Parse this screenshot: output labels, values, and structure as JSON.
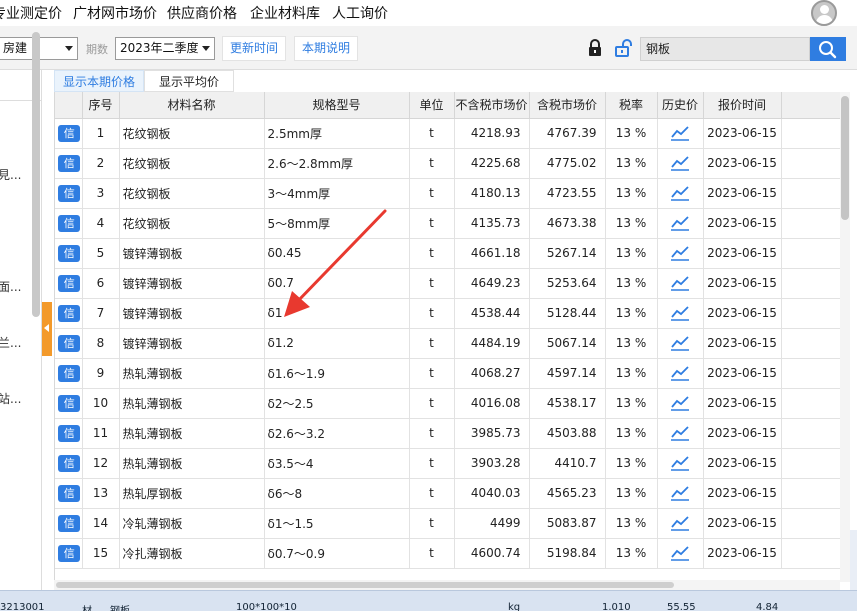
{
  "top_nav": {
    "items": [
      "专业测定价",
      "广材网市场价",
      "供应商价格",
      "企业材料库",
      "人工询价"
    ]
  },
  "toolbar": {
    "region_value": "房建",
    "period_label": "期数",
    "period_value": "2023年二季度",
    "update_time_label": "更新时间",
    "period_note_label": "本期说明",
    "search_value": "钢板"
  },
  "tabs": {
    "current": "显示本期价格",
    "average": "显示平均价"
  },
  "left_panel": {
    "fragments": [
      "見...",
      "面...",
      "兰...",
      "站..."
    ]
  },
  "table": {
    "headers": [
      "序号",
      "材料名称",
      "规格型号",
      "单位",
      "不含税市场价",
      "含税市场价",
      "税率",
      "历史价",
      "报价时间"
    ],
    "badge_text": "信",
    "rows": [
      [
        "1",
        "花纹钢板",
        "2.5mm厚",
        "t",
        "4218.93",
        "4767.39",
        "13 %",
        "2023-06-15"
      ],
      [
        "2",
        "花纹钢板",
        "2.6～2.8mm厚",
        "t",
        "4225.68",
        "4775.02",
        "13 %",
        "2023-06-15"
      ],
      [
        "3",
        "花纹钢板",
        "3～4mm厚",
        "t",
        "4180.13",
        "4723.55",
        "13 %",
        "2023-06-15"
      ],
      [
        "4",
        "花纹钢板",
        "5～8mm厚",
        "t",
        "4135.73",
        "4673.38",
        "13 %",
        "2023-06-15"
      ],
      [
        "5",
        "镀锌薄钢板",
        "δ0.45",
        "t",
        "4661.18",
        "5267.14",
        "13 %",
        "2023-06-15"
      ],
      [
        "6",
        "镀锌薄钢板",
        "δ0.7",
        "t",
        "4649.23",
        "5253.64",
        "13 %",
        "2023-06-15"
      ],
      [
        "7",
        "镀锌薄钢板",
        "δ1",
        "t",
        "4538.44",
        "5128.44",
        "13 %",
        "2023-06-15"
      ],
      [
        "8",
        "镀锌薄钢板",
        "δ1.2",
        "t",
        "4484.19",
        "5067.14",
        "13 %",
        "2023-06-15"
      ],
      [
        "9",
        "热轧薄钢板",
        "δ1.6～1.9",
        "t",
        "4068.27",
        "4597.14",
        "13 %",
        "2023-06-15"
      ],
      [
        "10",
        "热轧薄钢板",
        "δ2～2.5",
        "t",
        "4016.08",
        "4538.17",
        "13 %",
        "2023-06-15"
      ],
      [
        "11",
        "热轧薄钢板",
        "δ2.6～3.2",
        "t",
        "3985.73",
        "4503.88",
        "13 %",
        "2023-06-15"
      ],
      [
        "12",
        "热轧薄钢板",
        "δ3.5～4",
        "t",
        "3903.28",
        "4410.7",
        "13 %",
        "2023-06-15"
      ],
      [
        "13",
        "热轧厚钢板",
        "δ6～8",
        "t",
        "4040.03",
        "4565.23",
        "13 %",
        "2023-06-15"
      ],
      [
        "14",
        "冷轧薄钢板",
        "δ1～1.5",
        "t",
        "4499",
        "5083.87",
        "13 %",
        "2023-06-15"
      ],
      [
        "15",
        "冷扎薄钢板",
        "δ0.7～0.9",
        "t",
        "4600.74",
        "5198.84",
        "13 %",
        "2023-06-15"
      ]
    ]
  },
  "background_strip": {
    "fragments": [
      "3213001",
      "材",
      "钢板",
      "100*100*10",
      "kg",
      "1.010",
      "55.55",
      "4.84"
    ]
  },
  "colors": {
    "accent": "#2f7de1",
    "handle": "#f39a2b",
    "annotation_arrow": "#e8392f"
  },
  "icons": {
    "avatar": "user-avatar-icon",
    "lock": "lock-icon",
    "unlock": "unlock-icon",
    "search": "search-icon",
    "trend": "trend-chart-icon",
    "badge": "credit-badge-icon"
  }
}
